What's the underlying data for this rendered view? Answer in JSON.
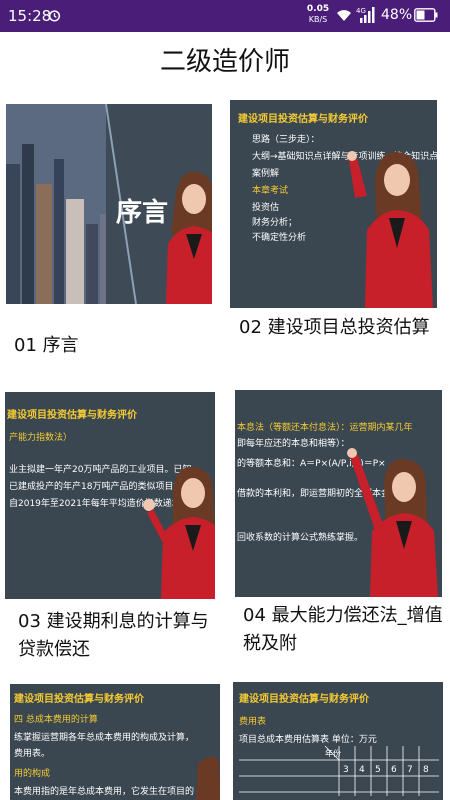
{
  "status_bar": {
    "time": "15:28",
    "net_speed": "0.05",
    "net_unit": "KB/S",
    "network_type": "4G",
    "battery": "48%",
    "icons": [
      "alarm-icon",
      "wifi-icon",
      "signal-icon",
      "battery-icon"
    ]
  },
  "header": {
    "title": "二级造价师"
  },
  "lessons": [
    {
      "title": "01 序言",
      "thumb": {
        "heading": "序言"
      }
    },
    {
      "title": "02 建设项目总投资估算",
      "thumb": {
        "heading": "建设项目投资估算与财务评价",
        "lines": [
          "思路（三步走）：",
          "大纲→基础知识点详解与专项训练→综合知识点",
          "案例解",
          "本章考试",
          "投资估",
          "财务分析；",
          "不确定性分析"
        ]
      }
    },
    {
      "title": "03 建设期利息的计算与贷款偿还",
      "thumb": {
        "heading": "建设项目投资估算与财务评价",
        "lines": [
          "产能力指数法）",
          "业主拟建一年产20万吨产品的工业项目。已知",
          "已建成投产的年产18万吨产品的类似项目投资额",
          "自2019年至2021年每年平均造价指数递增5%"
        ]
      }
    },
    {
      "title": "04 最大能力偿还法_增值税及附",
      "thumb": {
        "lines": [
          "本息法（等额还本付息法）：运营期内某几年",
          "即每年应还的本息和相等）：",
          "的等额本息和：A＝P×(A/P,i,n)＝P×",
          "借款的本利和，即运营期初的全部本金",
          "回收系数的计算公式熟练掌握。"
        ]
      }
    },
    {
      "title": "",
      "thumb": {
        "heading": "建设项目投资估算与财务评价",
        "lines": [
          "四 总成本费用的计算",
          "练掌握运营期各年总成本费用的构成及计算，",
          "费用表。",
          "用的构成",
          "本费用指的是年总成本费用，它发生在项目的"
        ]
      }
    },
    {
      "title": "",
      "thumb": {
        "heading": "建设项目投资估算与财务评价",
        "lines": [
          "费用表",
          "项目总成本费用估算表 单位：万元",
          "年份"
        ],
        "years": [
          "3",
          "4",
          "5",
          "6",
          "7",
          "8"
        ]
      }
    }
  ]
}
